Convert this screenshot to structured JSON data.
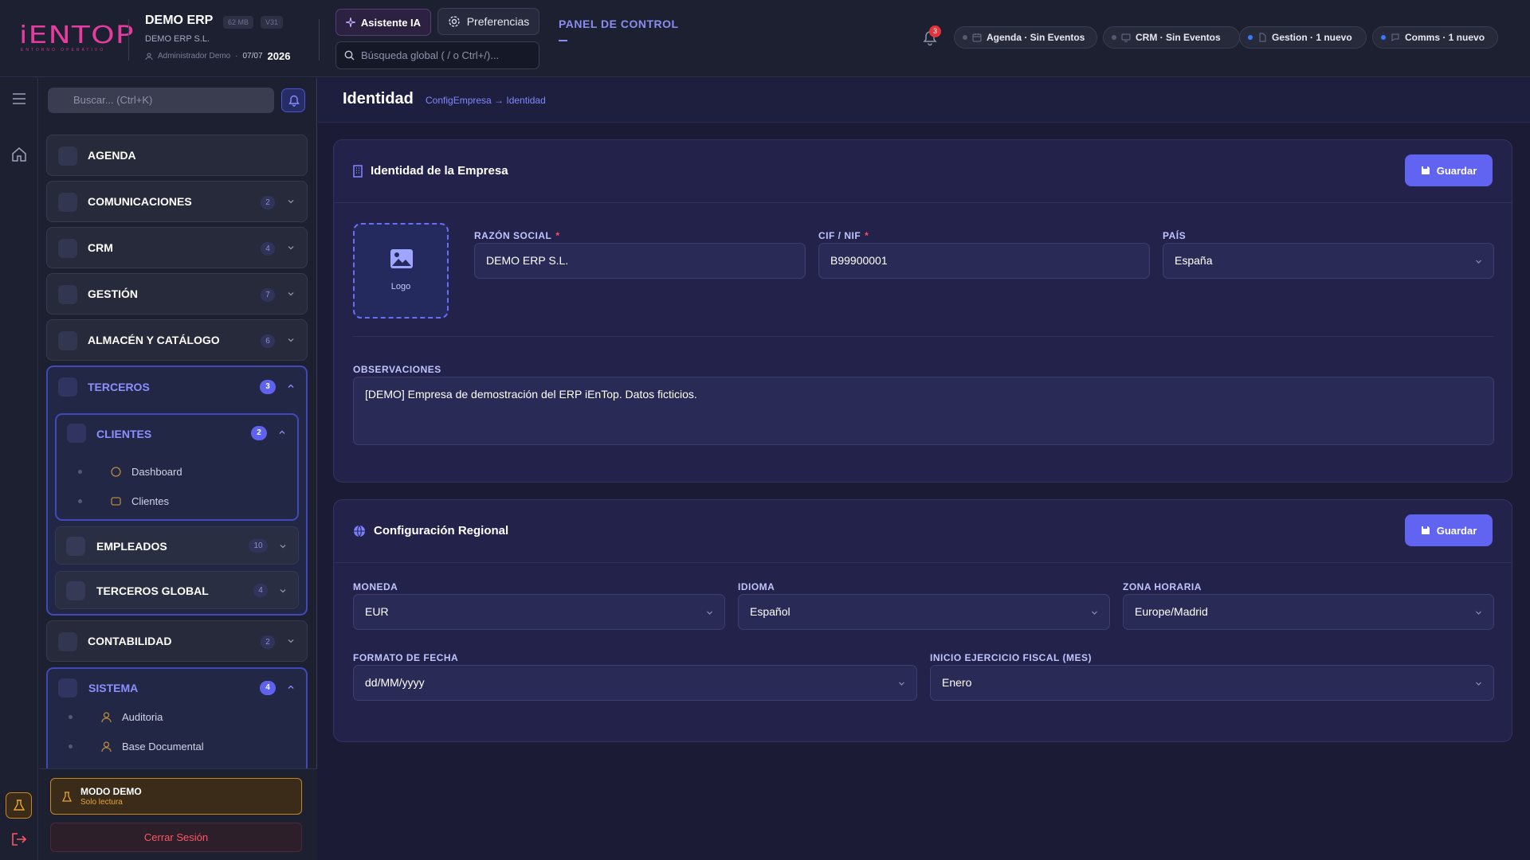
{
  "topbar": {
    "logo_text": "iENTOP",
    "logo_subtitle": "ENTORNO OPERATIVO",
    "app_name": "DEMO ERP",
    "size_chip": "62 MB",
    "version_chip": "V31",
    "company": "DEMO ERP S.L.",
    "user": "Administrador Demo",
    "date": "07/07",
    "year": "2026",
    "ai_button": "Asistente IA",
    "prefs_button": "Preferencias",
    "search_placeholder": "Búsqueda global ( / o Ctrl+/)...",
    "panel_title": "PANEL DE CONTROL",
    "bell_count": "3",
    "pills": [
      {
        "label": "Agenda · Sin Eventos",
        "status": "none"
      },
      {
        "label": "CRM · Sin Eventos",
        "status": "none"
      },
      {
        "label": "Gestion · 1 nuevo",
        "status": "new"
      },
      {
        "label": "Comms · 1 nuevo",
        "status": "new"
      }
    ]
  },
  "sidebar": {
    "search_placeholder": "Buscar... (Ctrl+K)",
    "items": [
      {
        "label": "AGENDA",
        "badge": ""
      },
      {
        "label": "COMUNICACIONES",
        "badge": "2"
      },
      {
        "label": "CRM",
        "badge": "4"
      },
      {
        "label": "GESTIÓN",
        "badge": "7"
      },
      {
        "label": "ALMACÉN Y CATÁLOGO",
        "badge": "6"
      }
    ],
    "terceros": {
      "label": "TERCEROS",
      "badge": "3",
      "clientes": {
        "label": "CLIENTES",
        "badge": "2",
        "children": [
          "Dashboard",
          "Clientes"
        ]
      },
      "empleados": {
        "label": "EMPLEADOS",
        "badge": "10"
      },
      "terceros_global": {
        "label": "TERCEROS GLOBAL",
        "badge": "4"
      }
    },
    "contabilidad": {
      "label": "CONTABILIDAD",
      "badge": "2"
    },
    "sistema": {
      "label": "SISTEMA",
      "badge": "4",
      "children": [
        "Auditoria",
        "Base Documental"
      ]
    },
    "demo_title": "MODO DEMO",
    "demo_subtitle": "Solo lectura",
    "logout": "Cerrar Sesión"
  },
  "page": {
    "title": "Identidad",
    "breadcrumb": "ConfigEmpresa → Identidad"
  },
  "identity_card": {
    "title": "Identidad de la Empresa",
    "save": "Guardar",
    "logo_label": "Logo",
    "razon_label": "RAZÓN SOCIAL",
    "razon_value": "DEMO ERP S.L.",
    "cif_label": "CIF / NIF",
    "cif_value": "B99900001",
    "pais_label": "PAÍS",
    "pais_value": "España",
    "obs_label": "OBSERVACIONES",
    "obs_value": "[DEMO] Empresa de demostración del ERP iEnTop. Datos ficticios.",
    "required_mark": "*"
  },
  "regional_card": {
    "title": "Configuración Regional",
    "save": "Guardar",
    "moneda_label": "MONEDA",
    "moneda_value": "EUR",
    "idioma_label": "IDIOMA",
    "idioma_value": "Español",
    "zona_label": "ZONA HORARIA",
    "zona_value": "Europe/Madrid",
    "fecha_label": "FORMATO DE FECHA",
    "fecha_value": "dd/MM/yyyy",
    "fiscal_label": "INICIO EJERCICIO FISCAL (MES)",
    "fiscal_value": "Enero"
  },
  "colors": {
    "accent": "#6064f0",
    "brand": "#e63ca0",
    "danger": "#ff4e5e",
    "warning": "#c9861d"
  }
}
